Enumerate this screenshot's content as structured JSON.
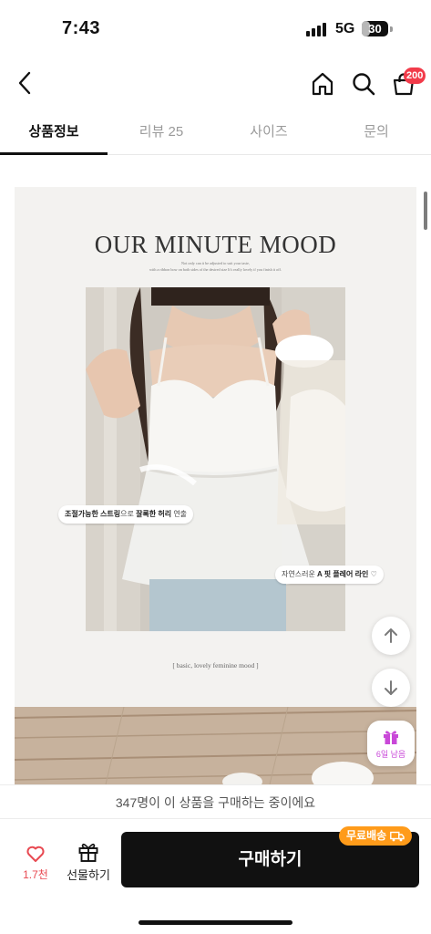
{
  "status_bar": {
    "time": "7:43",
    "network": "5G",
    "battery_level": "30",
    "battery_fraction": 0.3
  },
  "header": {
    "cart_badge": "200"
  },
  "tabs": [
    {
      "label": "상품정보",
      "active": true
    },
    {
      "label": "리뷰 25",
      "active": false
    },
    {
      "label": "사이즈",
      "active": false
    },
    {
      "label": "문의",
      "active": false
    }
  ],
  "detail_image": {
    "title": "OUR MINUTE MOOD",
    "subtitle_line1": "Not only can it be adjusted to suit your taste,",
    "subtitle_line2": "with a ribbon bow on both sides of the desired size It's really lovely if you finish it off.",
    "callout_1_bold_1": "조절가능한 스트링",
    "callout_1_text_1": "으로 ",
    "callout_1_bold_2": "잘록한 허리",
    "callout_1_text_2": " 연출",
    "callout_2_text_1": "자연스러운 ",
    "callout_2_bold": "A 핏 플레어 라인",
    "callout_2_text_2": " ♡",
    "caption": "[ basic, lovely feminine mood ]"
  },
  "floating": {
    "gift_label": "6일 남음"
  },
  "purchase_notice": "347명이 이 상품을 구매하는 중이에요",
  "bottom_bar": {
    "like_count": "1.7천",
    "gift_label": "선물하기",
    "buy_label": "구매하기",
    "free_shipping_label": "무료배송"
  },
  "colors": {
    "accent_red": "#f23b4a",
    "like_red": "#e84a52",
    "gift_purple": "#c948d8",
    "shipping_orange": "#ff9b1a",
    "buy_black": "#111111"
  },
  "icons": [
    "back-arrow-icon",
    "home-icon",
    "search-icon",
    "cart-icon",
    "arrow-up-icon",
    "arrow-down-icon",
    "gift-icon",
    "heart-icon",
    "truck-icon"
  ]
}
